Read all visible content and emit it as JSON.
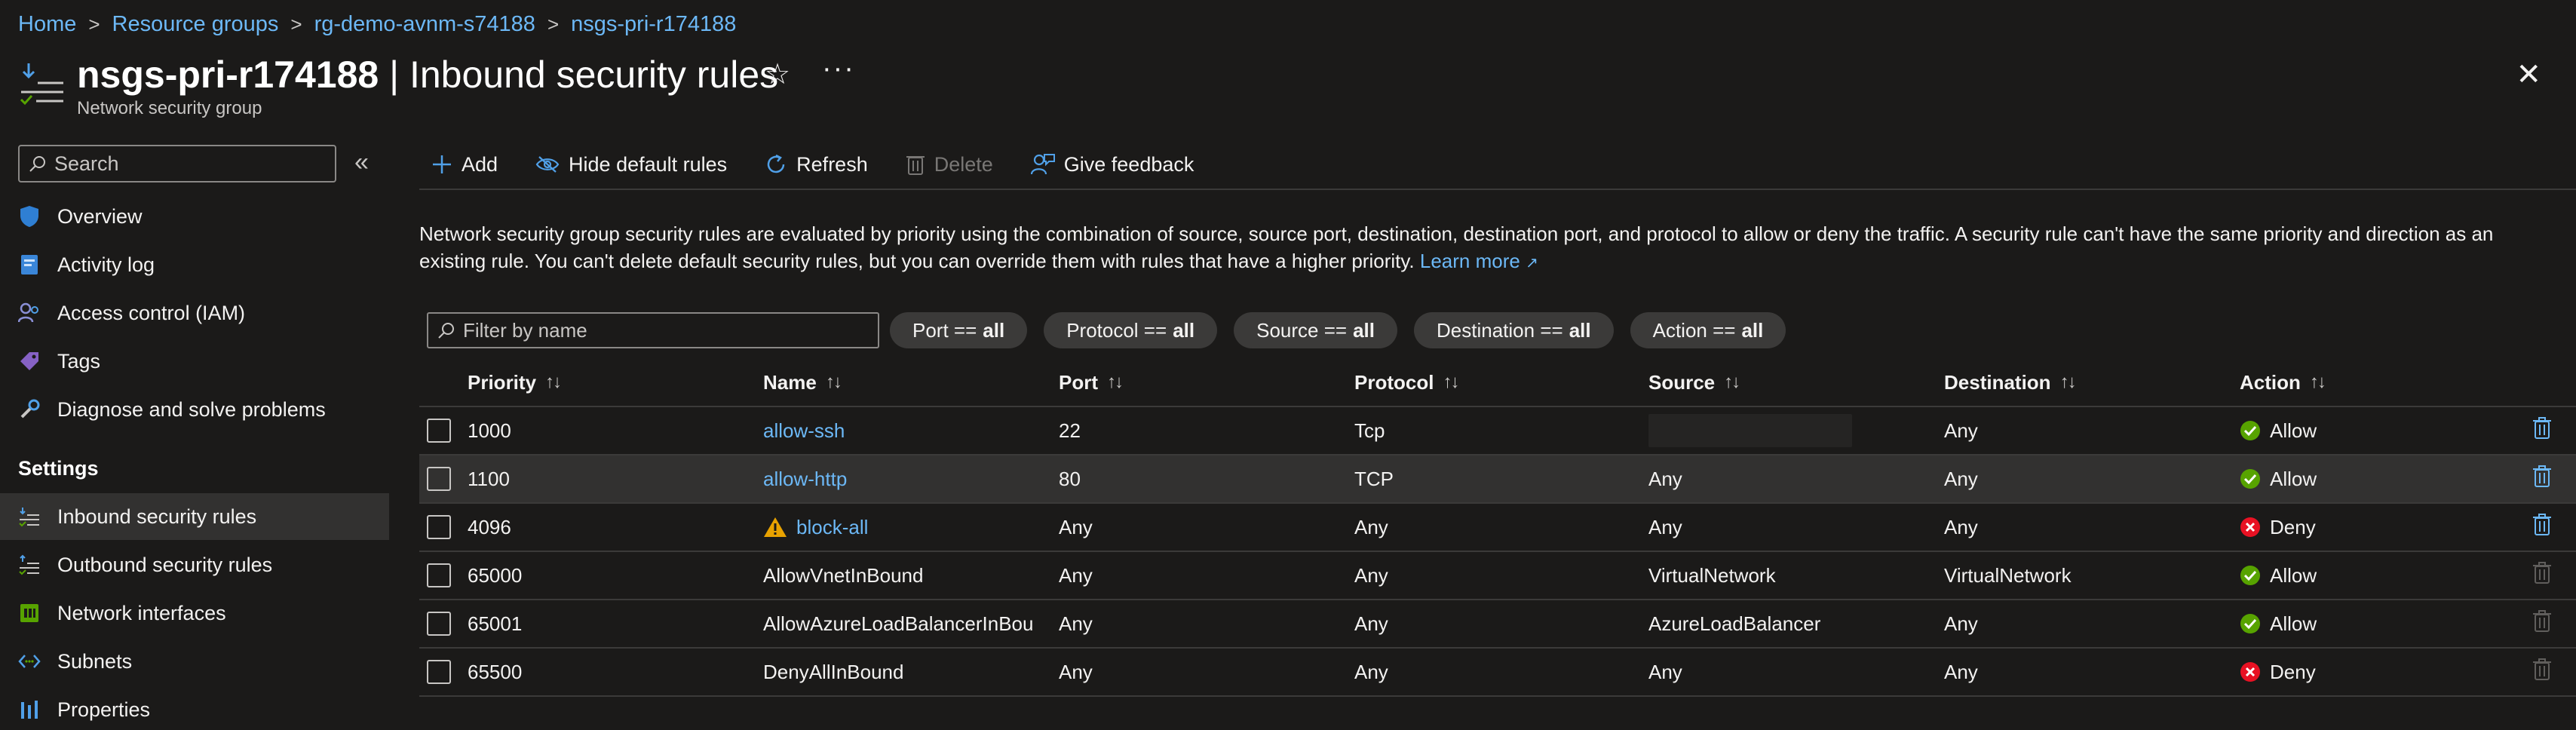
{
  "breadcrumb": [
    "Home",
    "Resource groups",
    "rg-demo-avnm-s74188",
    "nsgs-pri-r174188"
  ],
  "header": {
    "resource_name": "nsgs-pri-r174188",
    "page_name": " | Inbound security rules",
    "resource_type": "Network security group"
  },
  "sidebar": {
    "search_placeholder": "Search",
    "items": [
      {
        "label": "Overview",
        "icon": "shield-icon"
      },
      {
        "label": "Activity log",
        "icon": "activity-log-icon"
      },
      {
        "label": "Access control (IAM)",
        "icon": "people-icon"
      },
      {
        "label": "Tags",
        "icon": "tag-icon"
      },
      {
        "label": "Diagnose and solve problems",
        "icon": "wrench-icon"
      }
    ],
    "section_settings": "Settings",
    "settings_items": [
      {
        "label": "Inbound security rules",
        "icon": "inbound-rules-icon",
        "active": true
      },
      {
        "label": "Outbound security rules",
        "icon": "outbound-rules-icon"
      },
      {
        "label": "Network interfaces",
        "icon": "network-interface-icon"
      },
      {
        "label": "Subnets",
        "icon": "subnet-icon"
      },
      {
        "label": "Properties",
        "icon": "properties-icon"
      }
    ]
  },
  "toolbar": {
    "add": "Add",
    "hide_default": "Hide default rules",
    "refresh": "Refresh",
    "delete": "Delete",
    "feedback": "Give feedback"
  },
  "description": {
    "text": "Network security group security rules are evaluated by priority using the combination of source, source port, destination, destination port, and protocol to allow or deny the traffic. A security rule can't have the same priority and direction as an existing rule. You can't delete default security rules, but you can override them with rules that have a higher priority.",
    "learn_more": "Learn more"
  },
  "filters": {
    "name_placeholder": "Filter by name",
    "pills": [
      {
        "label": "Port ==",
        "value": "all"
      },
      {
        "label": "Protocol ==",
        "value": "all"
      },
      {
        "label": "Source ==",
        "value": "all"
      },
      {
        "label": "Destination ==",
        "value": "all"
      },
      {
        "label": "Action ==",
        "value": "all"
      }
    ]
  },
  "table": {
    "columns": [
      "Priority",
      "Name",
      "Port",
      "Protocol",
      "Source",
      "Destination",
      "Action"
    ],
    "rows": [
      {
        "priority": "1000",
        "name": "allow-ssh",
        "link": true,
        "warn": false,
        "port": "22",
        "protocol": "Tcp",
        "source": "",
        "redacted": true,
        "destination": "Any",
        "action": "Allow",
        "deletable": true
      },
      {
        "priority": "1100",
        "name": "allow-http",
        "link": true,
        "warn": false,
        "port": "80",
        "protocol": "TCP",
        "source": "Any",
        "redacted": false,
        "destination": "Any",
        "action": "Allow",
        "deletable": true
      },
      {
        "priority": "4096",
        "name": "block-all",
        "link": true,
        "warn": true,
        "port": "Any",
        "protocol": "Any",
        "source": "Any",
        "redacted": false,
        "destination": "Any",
        "action": "Deny",
        "deletable": true
      },
      {
        "priority": "65000",
        "name": "AllowVnetInBound",
        "link": false,
        "warn": false,
        "port": "Any",
        "protocol": "Any",
        "source": "VirtualNetwork",
        "redacted": false,
        "destination": "VirtualNetwork",
        "action": "Allow",
        "deletable": false
      },
      {
        "priority": "65001",
        "name": "AllowAzureLoadBalancerInBou...",
        "link": false,
        "warn": false,
        "port": "Any",
        "protocol": "Any",
        "source": "AzureLoadBalancer",
        "redacted": false,
        "destination": "Any",
        "action": "Allow",
        "deletable": false
      },
      {
        "priority": "65500",
        "name": "DenyAllInBound",
        "link": false,
        "warn": false,
        "port": "Any",
        "protocol": "Any",
        "source": "Any",
        "redacted": false,
        "destination": "Any",
        "action": "Deny",
        "deletable": false
      }
    ]
  },
  "colors": {
    "link": "#6cb8f6",
    "allow": "#57a300",
    "deny": "#e81123",
    "warning": "#fce100",
    "delete_enabled": "#6cb8f6",
    "delete_disabled": "#605e5c"
  }
}
